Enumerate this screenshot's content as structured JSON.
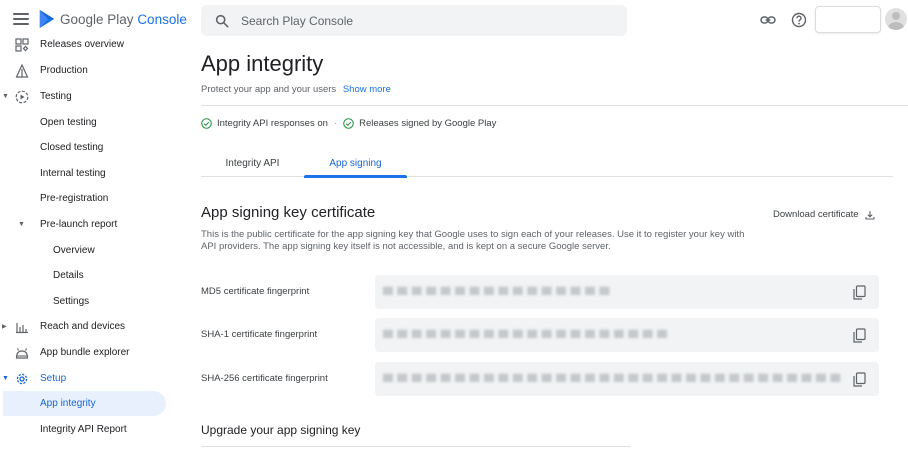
{
  "header": {
    "app_name_prefix": "Google Play",
    "app_name_accent": "Console",
    "search_placeholder": "Search Play Console",
    "icons": [
      "menu-icon",
      "play-console-logo",
      "search-icon",
      "link-icon",
      "help-icon",
      "account-avatar"
    ]
  },
  "sidebar": {
    "items": [
      {
        "label": "Releases overview",
        "icon": "releases-overview-icon"
      },
      {
        "label": "Production",
        "icon": "production-icon"
      },
      {
        "label": "Testing",
        "icon": "testing-icon"
      },
      {
        "label": "Open testing"
      },
      {
        "label": "Closed testing"
      },
      {
        "label": "Internal testing"
      },
      {
        "label": "Pre-registration"
      },
      {
        "label": "Pre-launch report"
      },
      {
        "label": "Overview"
      },
      {
        "label": "Details"
      },
      {
        "label": "Settings"
      },
      {
        "label": "Reach and devices",
        "icon": "reach-devices-icon"
      },
      {
        "label": "App bundle explorer",
        "icon": "app-bundle-icon"
      },
      {
        "label": "Setup",
        "icon": "setup-gear-icon"
      },
      {
        "label": "App integrity"
      },
      {
        "label": "Integrity API Report"
      }
    ]
  },
  "page": {
    "title": "App integrity",
    "subtitle": "Protect your app and your users",
    "show_more": "Show more",
    "status": [
      {
        "label": "Integrity API responses on"
      },
      {
        "label": "Releases signed by Google Play"
      }
    ],
    "status_separator": "·",
    "tabs": [
      {
        "label": "Integrity API",
        "active": false
      },
      {
        "label": "App signing",
        "active": true
      }
    ]
  },
  "signing": {
    "title": "App signing key certificate",
    "download_label": "Download certificate",
    "description": "This is the public certificate for the app signing key that Google uses to sign each of your releases. Use it to register your key with API providers. The app signing key itself is not accessible, and is kept on a secure Google server.",
    "fingerprints": [
      {
        "label": "MD5 certificate fingerprint"
      },
      {
        "label": "SHA-1 certificate fingerprint"
      },
      {
        "label": "SHA-256 certificate fingerprint"
      }
    ]
  },
  "upgrade": {
    "title": "Upgrade your app signing key"
  },
  "colors": {
    "accent": "#1a73e8",
    "active_bg": "#e8f0fe",
    "field_bg": "#f1f3f4",
    "success": "#1e8e3e"
  }
}
